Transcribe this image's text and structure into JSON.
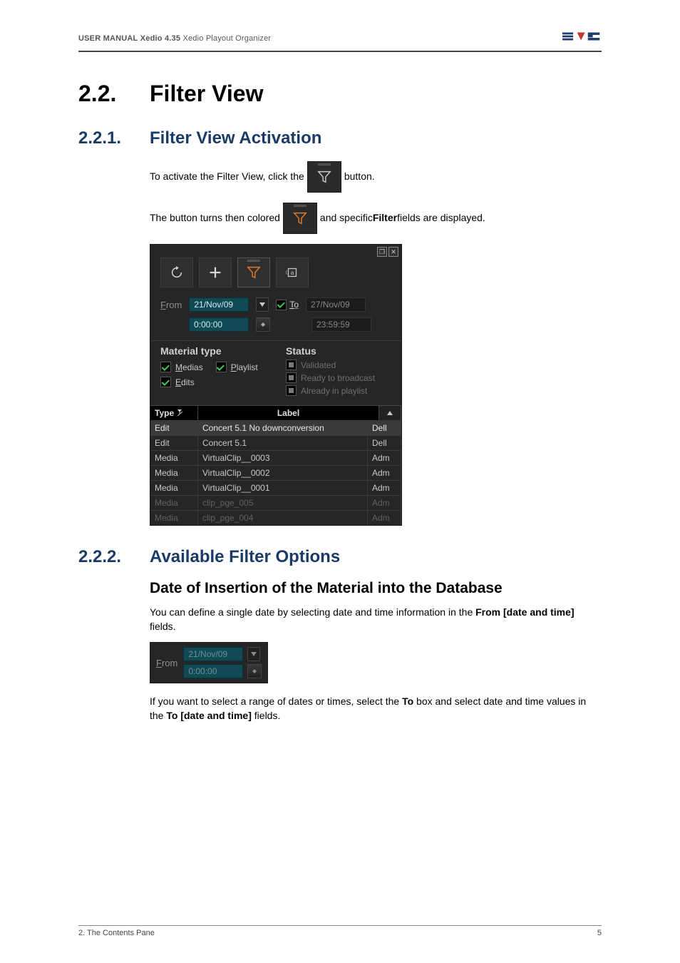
{
  "header": {
    "manual": "USER MANUAL",
    "product": "Xedio 4.35",
    "module": "Xedio Playout Organizer"
  },
  "section": {
    "h2_num": "2.2.",
    "h2_title": "Filter View",
    "h3a_num": "2.2.1.",
    "h3a_title": "Filter View Activation",
    "h3b_num": "2.2.2.",
    "h3b_title": "Available Filter Options",
    "h4a_title": "Date of Insertion of the Material into the Database"
  },
  "text": {
    "activate_pre": "To activate the Filter View, click the",
    "activate_post": "button.",
    "colored_pre": "The button turns then colored",
    "colored_post_a": "and specific ",
    "colored_post_b": "Filter",
    "colored_post_c": " fields are displayed.",
    "date_single_a": "You can define a single date by selecting date and time information in the ",
    "date_single_b": "From [date and time]",
    "date_single_c": " fields.",
    "date_range_a": "If you want to select a range of dates or times, select the ",
    "date_range_b": "To",
    "date_range_c": " box and select date and time values in the ",
    "date_range_d": "To [date and time]",
    "date_range_e": " fields."
  },
  "filter_panel": {
    "from_label": "From",
    "from_date": "21/Nov/09",
    "from_time": "0:00:00",
    "to_label_prefix": "T",
    "to_label_rest": "o",
    "to_date": "27/Nov/09",
    "to_time": "23:59:59",
    "material_title": "Material type",
    "status_title": "Status",
    "chk_medias_prefix": "M",
    "chk_medias_rest": "edias",
    "chk_playlist_prefix": "P",
    "chk_playlist_rest": "laylist",
    "chk_edits_prefix": "E",
    "chk_edits_rest": "dits",
    "chk_validated": "Validated",
    "chk_ready": "Ready to broadcast",
    "chk_already": "Already in playlist",
    "grid": {
      "head_type": "Type",
      "head_label": "Label",
      "rows": [
        {
          "type": "Edit",
          "label": "Concert 5.1 No downconversion",
          "last": "Dell",
          "hl": true
        },
        {
          "type": "Edit",
          "label": "Concert 5.1",
          "last": "Dell"
        },
        {
          "type": "Media",
          "label": "VirtualClip__0003",
          "last": "Adm"
        },
        {
          "type": "Media",
          "label": "VirtualClip__0002",
          "last": "Adm"
        },
        {
          "type": "Media",
          "label": "VirtualClip__0001",
          "last": "Adm"
        },
        {
          "type": "Media",
          "label": "clip_pge_005",
          "last": "Adm",
          "dim": true
        },
        {
          "type": "Media",
          "label": "clip_pge_004",
          "last": "Adm",
          "dim": true
        }
      ]
    }
  },
  "mini_from": {
    "label": "From",
    "date": "21/Nov/09",
    "time": "0:00:00"
  },
  "footer": {
    "left": "2. The Contents Pane",
    "right": "5"
  }
}
